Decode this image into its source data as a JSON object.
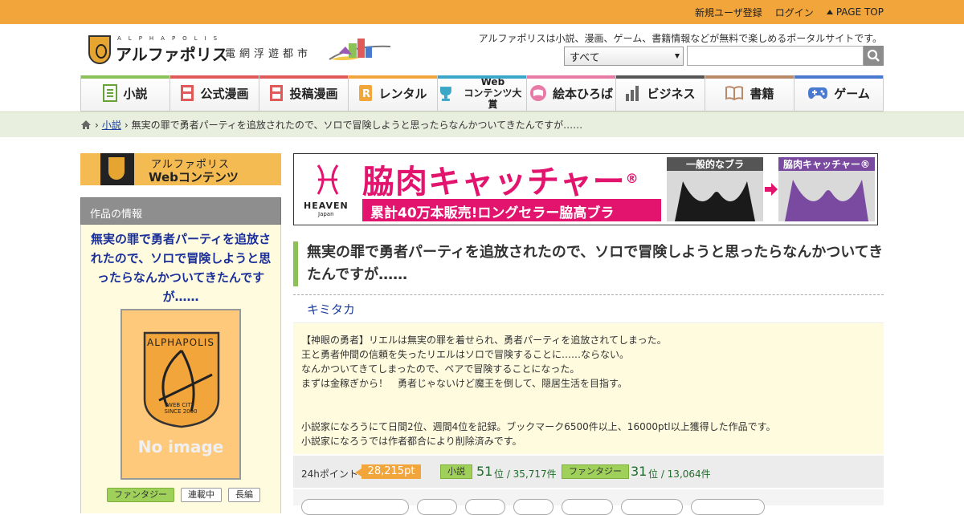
{
  "toplinks": {
    "register": "新規ユーザ登録",
    "login": "ログイン",
    "pagetop": "PAGE TOP"
  },
  "header": {
    "logo_sub": "ALPHAPOLIS",
    "logo_name": "アルファポリス",
    "logo_city": "電網浮遊都市",
    "tagline": "アルファポリスは小説、漫画、ゲーム、書籍情報などが無料で楽しめるポータルサイトです。",
    "search_select": "すべて",
    "search_icon": "search-icon"
  },
  "nav": {
    "items": [
      {
        "label": "小説",
        "color": "#8cc158",
        "icon": "book-icon"
      },
      {
        "label": "公式漫画",
        "color": "#e05a5a",
        "icon": "manga-icon"
      },
      {
        "label": "投稿漫画",
        "color": "#e05a5a",
        "icon": "manga-icon"
      },
      {
        "label": "レンタル",
        "color": "#f2a53a",
        "icon": "rental-icon"
      },
      {
        "label_line1": "Web",
        "label_line2": "コンテンツ大賞",
        "color": "#3aa6c8",
        "icon": "trophy-icon"
      },
      {
        "label": "絵本ひろば",
        "color": "#e87aa8",
        "icon": "picture-book-icon"
      },
      {
        "label": "ビジネス",
        "color": "#555555",
        "icon": "business-icon"
      },
      {
        "label": "書籍",
        "color": "#b98a6a",
        "icon": "open-book-icon"
      },
      {
        "label": "ゲーム",
        "color": "#4a7ad0",
        "icon": "gamepad-icon"
      }
    ]
  },
  "breadcrumb": {
    "home_icon": "home-icon",
    "link": "小説",
    "current": "無実の罪で勇者パーティを追放されたので、ソロで冒険しようと思ったらなんかついてきたんですが……"
  },
  "sidebar": {
    "webc_line1": "アルファポリス",
    "webc_line2": "Webコンテンツ",
    "info_head": "作品の情報",
    "title": "無実の罪で勇者パーティを追放されたので、ソロで冒険しようと思ったらなんかついてきたんですが……",
    "cover_text": "ALPHAPOLIS",
    "cover_sub1": "WEB CITY",
    "cover_sub2": "SINCE 2000",
    "no_image": "No image",
    "tags": [
      "ファンタジー",
      "連載中",
      "長編"
    ]
  },
  "ad": {
    "brand": "HEAVEN",
    "brand_sub": "Japan",
    "title": "脇肉キャッチャー",
    "reg": "®",
    "sub": "累計40万本販売!ロングセラー脇高ブラ",
    "cap1": "一般的なブラ",
    "cap2": "脇肉キャッチャー®"
  },
  "work": {
    "title": "無実の罪で勇者パーティを追放されたので、ソロで冒険しようと思ったらなんかついてきたんですが……",
    "author": "キミタカ",
    "summary": [
      "【神眼の勇者】リエルは無実の罪を着せられ、勇者パーティを追放されてしまった。",
      "王と勇者仲間の信頼を失ったリエルはソロで冒険することに……ならない。",
      "なんかついてきてしまったので、ペアで冒険することになった。",
      "まずは金稼ぎから！　勇者じゃないけど魔王を倒して、隠居生活を目指す。",
      "",
      "",
      "小説家になろうにて日間2位、週間4位を記録。ブックマーク6500件以上、16000ptl以上獲得した作品です。",
      "小説家になろうでは作者都合により削除済みです。"
    ],
    "stats": {
      "label": "24hポイント",
      "points": "28,215pt",
      "rank1_tag": "小説",
      "rank1_num": "51",
      "rank1_rest": "位 / 35,717件",
      "rank2_tag": "ファンタジー",
      "rank2_num": "31",
      "rank2_rest": "位 / 13,064件"
    }
  }
}
